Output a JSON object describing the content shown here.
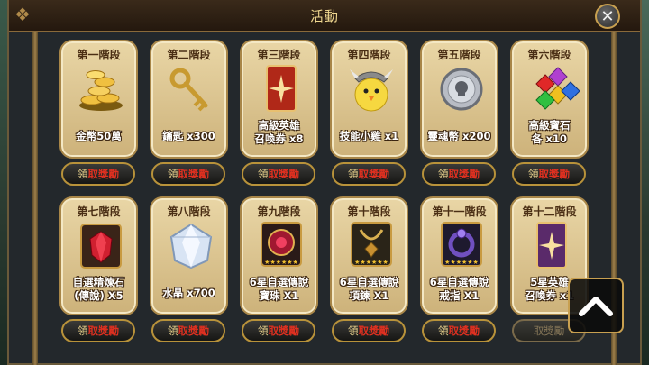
{
  "window": {
    "title": "活動",
    "close_label": "✕"
  },
  "stages": [
    {
      "label": "第一階段",
      "reward_lines": [
        "金幣50萬"
      ],
      "icon": "gold-coins-icon",
      "claim_a": "領",
      "claim_b": "取獎勵",
      "claim_enabled": true
    },
    {
      "label": "第二階段",
      "reward_lines": [
        "鑰匙 x300"
      ],
      "icon": "key-icon",
      "claim_a": "領",
      "claim_b": "取獎勵",
      "claim_enabled": true
    },
    {
      "label": "第三階段",
      "reward_lines": [
        "高級英雄",
        "召喚券 x8"
      ],
      "icon": "hero-summon-ticket-icon",
      "claim_a": "領",
      "claim_b": "取獎勵",
      "claim_enabled": true
    },
    {
      "label": "第四階段",
      "reward_lines": [
        "技能小雞 x1"
      ],
      "icon": "skill-chick-icon",
      "claim_a": "領",
      "claim_b": "取獎勵",
      "claim_enabled": true
    },
    {
      "label": "第五階段",
      "reward_lines": [
        "靈魂幣 x200"
      ],
      "icon": "soul-coin-icon",
      "claim_a": "領",
      "claim_b": "取獎勵",
      "claim_enabled": true
    },
    {
      "label": "第六階段",
      "reward_lines": [
        "高級寶石",
        "各 x10"
      ],
      "icon": "gems-icon",
      "claim_a": "領",
      "claim_b": "取獎勵",
      "claim_enabled": true
    },
    {
      "label": "第七階段",
      "reward_lines": [
        "自選精煉石",
        "(傳說) X5"
      ],
      "icon": "refining-stone-icon",
      "claim_a": "領",
      "claim_b": "取獎勵",
      "claim_enabled": true
    },
    {
      "label": "第八階段",
      "reward_lines": [
        "水晶 x700"
      ],
      "icon": "crystal-icon",
      "claim_a": "領",
      "claim_b": "取獎勵",
      "claim_enabled": true
    },
    {
      "label": "第九階段",
      "reward_lines": [
        "6星自選傳說",
        "寶珠 X1"
      ],
      "icon": "legendary-orb-icon",
      "claim_a": "領",
      "claim_b": "取獎勵",
      "claim_enabled": true
    },
    {
      "label": "第十階段",
      "reward_lines": [
        "6星自選傳說",
        "項鍊 X1"
      ],
      "icon": "legendary-necklace-icon",
      "claim_a": "領",
      "claim_b": "取獎勵",
      "claim_enabled": true
    },
    {
      "label": "第十一階段",
      "reward_lines": [
        "6星自選傳說",
        "戒指 X1"
      ],
      "icon": "legendary-ring-icon",
      "claim_a": "領",
      "claim_b": "取獎勵",
      "claim_enabled": true
    },
    {
      "label": "第十二階段",
      "reward_lines": [
        "5星英雄",
        "召喚券 x1"
      ],
      "icon": "hero-summon-ticket-5star-icon",
      "claim_a": "",
      "claim_b": "取獎勵",
      "claim_enabled": false
    }
  ],
  "scroll_top": {
    "icon": "chevron-up-icon"
  }
}
